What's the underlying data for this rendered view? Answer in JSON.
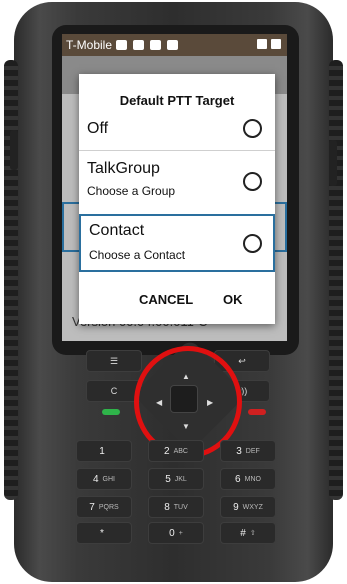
{
  "status": {
    "carrier": "T-Mobile"
  },
  "dialog": {
    "title": "Default PTT Target",
    "options": [
      {
        "label": "Off",
        "sub": ""
      },
      {
        "label": "TalkGroup",
        "sub": "Choose a Group"
      },
      {
        "label": "Contact",
        "sub": "Choose a Contact"
      }
    ],
    "cancel_label": "CANCEL",
    "ok_label": "OK"
  },
  "background": {
    "version_text": "Version 00.04.00.011-C"
  },
  "keypad": {
    "c_label": "C",
    "rows": [
      [
        {
          "num": "1",
          "letters": ""
        },
        {
          "num": "2",
          "letters": "ABC"
        },
        {
          "num": "3",
          "letters": "DEF"
        }
      ],
      [
        {
          "num": "4",
          "letters": "GHI"
        },
        {
          "num": "5",
          "letters": "JKL"
        },
        {
          "num": "6",
          "letters": "MNO"
        }
      ],
      [
        {
          "num": "7",
          "letters": "PQRS"
        },
        {
          "num": "8",
          "letters": "TUV"
        },
        {
          "num": "9",
          "letters": "WXYZ"
        }
      ],
      [
        {
          "num": "*",
          "letters": ""
        },
        {
          "num": "0",
          "letters": "+"
        },
        {
          "num": "#",
          "letters": "⇧"
        }
      ]
    ]
  },
  "colors": {
    "highlight_border": "#2a6f9e",
    "annotation_circle": "#e01010"
  }
}
